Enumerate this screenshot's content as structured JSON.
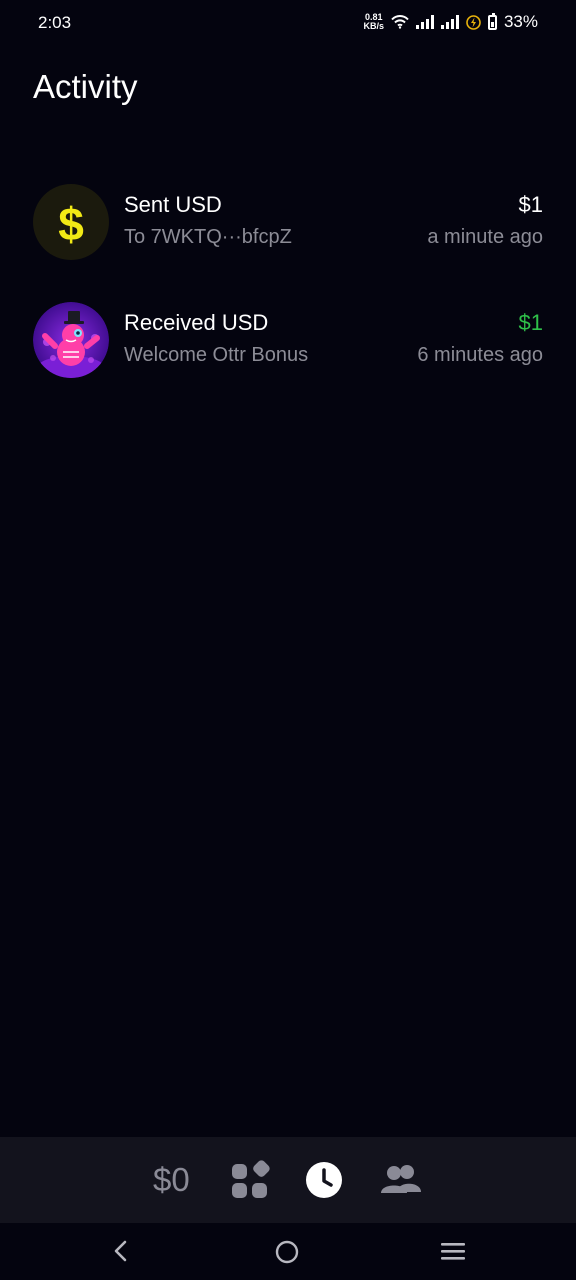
{
  "status_bar": {
    "time": "2:03",
    "net_speed_value": "0.81",
    "net_speed_unit": "KB/s",
    "battery_percent": "33%"
  },
  "header": {
    "title": "Activity"
  },
  "activity": [
    {
      "title": "Sent USD",
      "subtitle": "To 7WKTQ···bfcpZ",
      "amount": "$1",
      "amount_color": "#ffffff",
      "time": "a minute ago",
      "avatar_icon": "dollar-icon"
    },
    {
      "title": "Received USD",
      "subtitle": "Welcome Ottr Bonus",
      "amount": "$1",
      "amount_color": "#2fc14a",
      "time": "6 minutes ago",
      "avatar_icon": "ottr-mascot-icon"
    }
  ],
  "tab_bar": {
    "balance": "$0",
    "tabs": [
      {
        "icon": "apps-grid-icon",
        "active": false
      },
      {
        "icon": "clock-icon",
        "active": true
      },
      {
        "icon": "people-icon",
        "active": false
      }
    ]
  },
  "colors": {
    "background": "#04040f",
    "secondary_text": "#8c8c96",
    "positive": "#2fc14a",
    "dollar_yellow": "#f2ea15"
  }
}
